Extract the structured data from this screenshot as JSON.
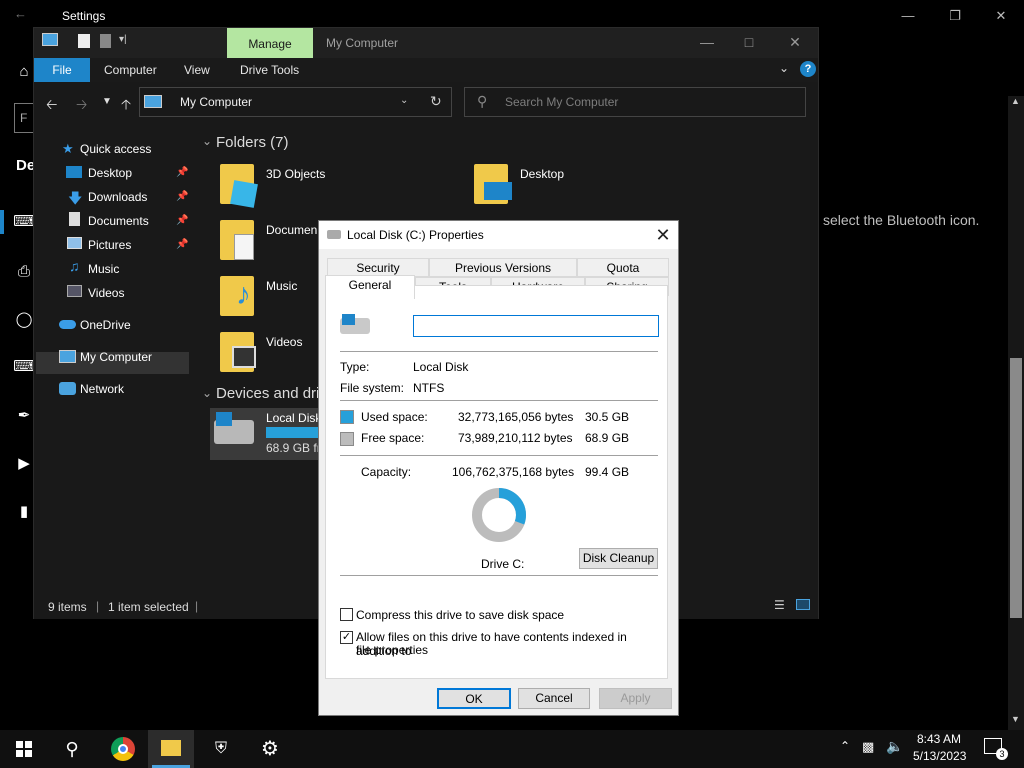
{
  "settings": {
    "title": "Settings",
    "bluetooth_hint": "select the Bluetooth icon.",
    "heading_partial": "De",
    "search_partial": "F"
  },
  "explorer": {
    "manage_tab": "Manage",
    "title": "My Computer",
    "ribbon_tabs": [
      "File",
      "Computer",
      "View",
      "Drive Tools"
    ],
    "address": "My Computer",
    "search_placeholder": "Search My Computer",
    "nav": {
      "quick_access": "Quick access",
      "items": [
        "Desktop",
        "Downloads",
        "Documents",
        "Pictures",
        "Music",
        "Videos"
      ],
      "onedrive": "OneDrive",
      "my_computer": "My Computer",
      "network": "Network"
    },
    "folders_header": "Folders (7)",
    "folders": [
      "3D Objects",
      "Desktop",
      "Documen",
      "Music",
      "Videos"
    ],
    "devices_header": "Devices and dri",
    "drive_label": "Local Disk",
    "drive_free": "68.9 GB fr",
    "status": {
      "items": "9 items",
      "selected": "1 item selected"
    }
  },
  "dialog": {
    "title": "Local Disk (C:) Properties",
    "tabs_row1": [
      "Security",
      "Previous Versions",
      "Quota"
    ],
    "tabs_row2": [
      "General",
      "Tools",
      "Hardware",
      "Sharing"
    ],
    "name_value": "",
    "type_label": "Type:",
    "type_value": "Local Disk",
    "fs_label": "File system:",
    "fs_value": "NTFS",
    "used_label": "Used space:",
    "used_bytes": "32,773,165,056 bytes",
    "used_gb": "30.5 GB",
    "free_label": "Free space:",
    "free_bytes": "73,989,210,112 bytes",
    "free_gb": "68.9 GB",
    "cap_label": "Capacity:",
    "cap_bytes": "106,762,375,168 bytes",
    "cap_gb": "99.4 GB",
    "drive_caption": "Drive C:",
    "cleanup": "Disk Cleanup",
    "compress": "Compress this drive to save disk space",
    "compress_checked": false,
    "index_line1": "Allow files on this drive to have contents indexed in addition to",
    "index_line2": "file properties",
    "index_checked": true,
    "ok": "OK",
    "cancel": "Cancel",
    "apply": "Apply",
    "used_color": "#26a0da",
    "free_color": "#bcbcbc",
    "used_fraction": 0.307
  },
  "taskbar": {
    "time": "8:43 AM",
    "date": "5/13/2023",
    "notifications": "3"
  }
}
